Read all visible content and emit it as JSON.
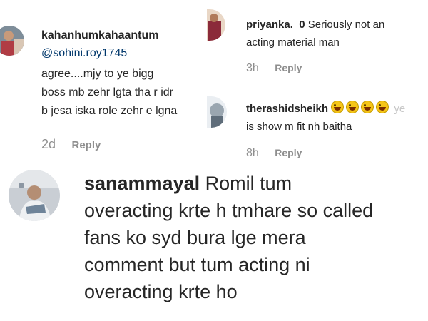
{
  "comments": [
    {
      "username": "kahanhumkahaantum",
      "mention": "@sohini.roy1745",
      "lines": [
        "agree....mjy to ye bigg",
        "boss mb zehr lgta tha r idr",
        "b jesa iska role zehr e lgna"
      ],
      "time": "2d",
      "reply_label": "Reply"
    },
    {
      "username": "priyanka._0",
      "lines": [
        "Seriously not an",
        "acting material man"
      ],
      "time": "3h",
      "reply_label": "Reply"
    },
    {
      "username": "therashidsheikh",
      "emoji_suffix": "ye",
      "lines": [
        "is show m fit nh baitha"
      ],
      "time": "8h",
      "reply_label": "Reply",
      "emoji_icons": [
        "grinning-emoji",
        "grinning-emoji",
        "grinning-emoji",
        "grinning-emoji"
      ]
    },
    {
      "username": "sanammayal",
      "first_line": "Romil tum",
      "lines": [
        "overacting krte h tmhare so called",
        "fans ko syd bura lge mera",
        "comment but tum acting ni",
        "overacting krte ho"
      ]
    }
  ],
  "colors": {
    "text": "#262626",
    "meta": "#8e8e8e",
    "mention": "#00376b"
  }
}
